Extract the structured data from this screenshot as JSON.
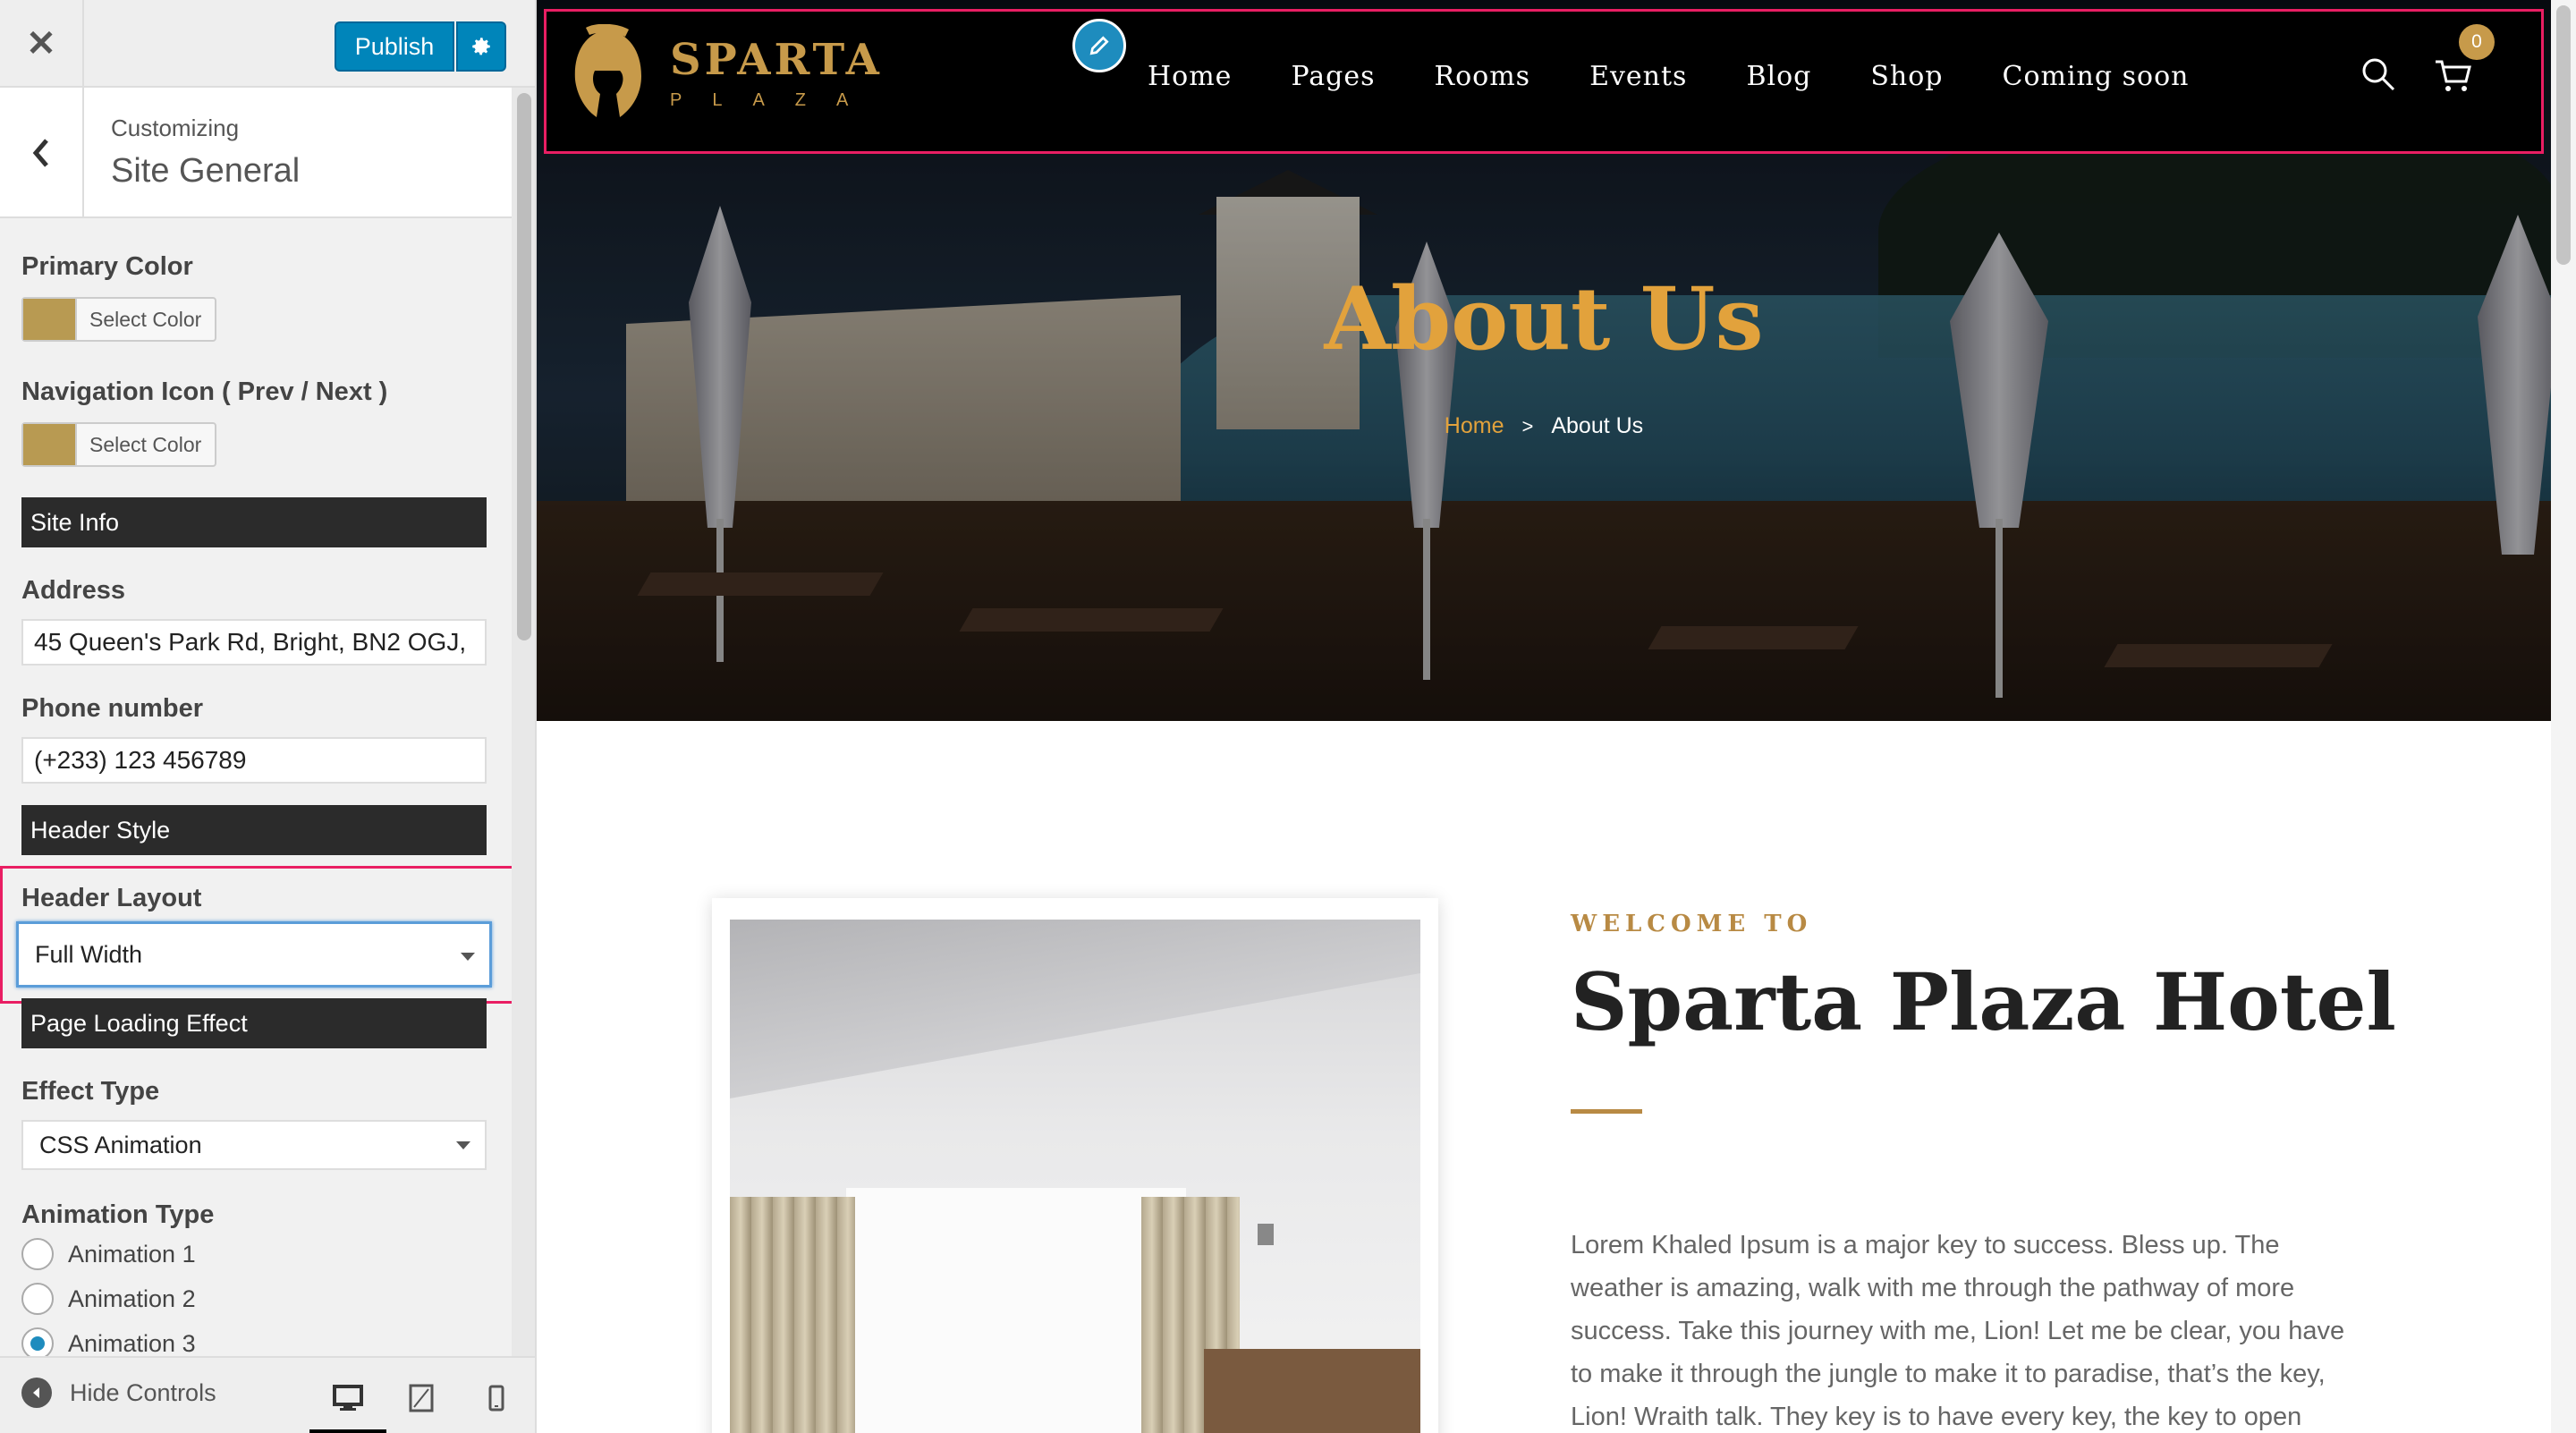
{
  "sidebar": {
    "publish_label": "Publish",
    "customizing_label": "Customizing",
    "section_title": "Site General",
    "primary_color_label": "Primary Color",
    "primary_color_value": "#b89a52",
    "select_color_label": "Select Color",
    "nav_icon_label": "Navigation Icon ( Prev / Next )",
    "nav_icon_color_value": "#b89a52",
    "site_info_heading": "Site Info",
    "address_label": "Address",
    "address_value": "45 Queen's Park Rd, Bright, BN2 OGJ,",
    "phone_label": "Phone number",
    "phone_value": "(+233) 123 456789",
    "header_style_heading": "Header Style",
    "header_layout_label": "Header Layout",
    "header_layout_value": "Full Width",
    "page_loading_heading": "Page Loading Effect",
    "effect_type_label": "Effect Type",
    "effect_type_value": "CSS Animation",
    "animation_type_label": "Animation Type",
    "animations": [
      "Animation 1",
      "Animation 2",
      "Animation 3"
    ],
    "selected_animation": "Animation 3",
    "hide_controls_label": "Hide Controls",
    "icons": [
      "close-icon",
      "gear-icon",
      "chevron-left-icon",
      "desktop-icon",
      "tablet-icon",
      "mobile-icon"
    ]
  },
  "site": {
    "brand_name": "SPARTA",
    "brand_sub": "PLAZA",
    "nav": [
      "Home",
      "Pages",
      "Rooms",
      "Events",
      "Blog",
      "Shop",
      "Coming soon"
    ],
    "cart_count": "0",
    "hero_title": "About Us",
    "breadcrumb_home": "Home",
    "breadcrumb_sep": ">",
    "breadcrumb_current": "About Us",
    "welcome": "WELCOME TO",
    "hotel_title": "Sparta Plaza Hotel",
    "lorem": "Lorem Khaled Ipsum is a major key to success. Bless up. The weather is amazing, walk with me through the pathway of more success. Take this journey with me, Lion! Let me be clear, you have to make it through the jungle to make it to paradise, that’s the key, Lion! Wraith talk. They key is to have every key, the key to open",
    "accent_color": "#c79a4a",
    "highlight_color": "#e91e63"
  }
}
